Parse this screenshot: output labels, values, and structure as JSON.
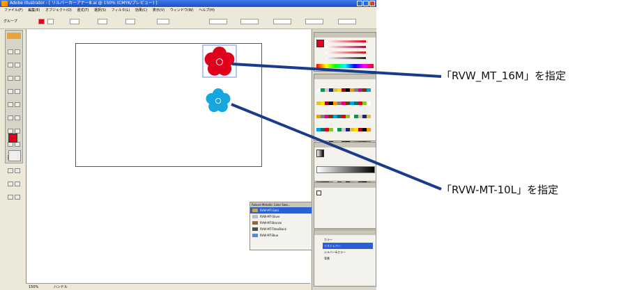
{
  "window": {
    "title": "Adobe Illustrator - [ リルバーカーアナー8.ai @ 150% (CMYK/プレビュー) ]"
  },
  "menu": [
    "ファイル(F)",
    "編集(E)",
    "オブジェクト(O)",
    "書式(T)",
    "選択(S)",
    "フィルタ(L)",
    "効果(C)",
    "表示(V)",
    "ウィンドウ(W)",
    "ヘルプ(H)"
  ],
  "control_bar": {
    "selection_label": "グループ"
  },
  "status_bar": {
    "zoom": "150%",
    "tool": "ハンドル"
  },
  "colors": {
    "red_flower": "#e0001b",
    "blue_flower": "#18a6e0",
    "callout_line": "#1a3b8c",
    "titlebar": "#2a5fd6"
  },
  "swatch_panel": {
    "title": "Roland Metallic Color Swa...",
    "items": [
      {
        "label": "RVW-MT-Gold",
        "color": "#c8a24a",
        "selected": true
      },
      {
        "label": "RVW-MT-Silver",
        "color": "#b9bcc2",
        "selected": false
      },
      {
        "label": "RVW-MT-Bronze",
        "color": "#8e6b3e",
        "selected": false
      },
      {
        "label": "RVW-MT-TitanBlack",
        "color": "#4b4d52",
        "selected": false
      },
      {
        "label": "RVW-MT-Blue",
        "color": "#5d86c4",
        "selected": false
      }
    ]
  },
  "layers_panel": {
    "items": [
      "カラー",
      "リストレバー",
      "シルバー&カラー",
      "背景"
    ]
  },
  "callouts": [
    {
      "text": "「RVW_MT_16M」を指定"
    },
    {
      "text": "「RVW-MT-10L」を指定"
    }
  ]
}
